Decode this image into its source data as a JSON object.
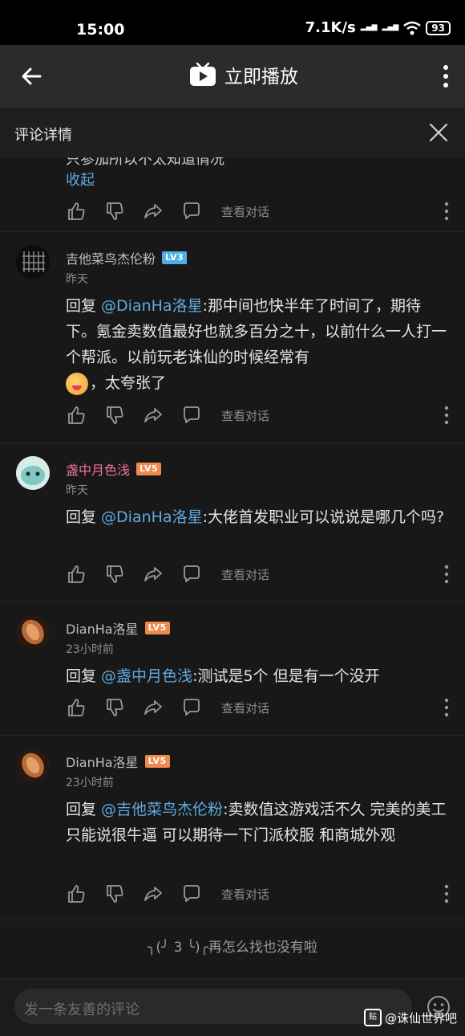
{
  "status_bar": {
    "time": "15:00",
    "net_speed": "7.1K/s",
    "battery": "93"
  },
  "topbar": {
    "title": "立即播放"
  },
  "panel": {
    "title": "评论详情"
  },
  "partial_comment": {
    "text": "只参加所以不太知道情况",
    "collapse": "收起",
    "view_conversation": "查看对话"
  },
  "comments": [
    {
      "username": "吉他菜鸟杰伦粉",
      "level": "LV3",
      "time": "昨天",
      "reply_prefix": "回复 ",
      "mention": "@DianHa洛星",
      "text": ":那中间也快半年了时间了，期待下。氪金卖数值最好也就多百分之十，以前什么一人打一个帮派。以前玩老诛仙的时候经常有",
      "text_after_emoji": "，太夸张了",
      "view_conversation": "查看对话"
    },
    {
      "username": "盏中月色浅",
      "level": "LV5",
      "time": "昨天",
      "reply_prefix": "回复 ",
      "mention": "@DianHa洛星",
      "text": ":大佬首发职业可以说说是哪几个吗?",
      "view_conversation": "查看对话"
    },
    {
      "username": "DianHa洛星",
      "level": "LV5",
      "time": "23小时前",
      "reply_prefix": "回复 ",
      "mention": "@盏中月色浅",
      "text": ":测试是5个 但是有一个没开",
      "view_conversation": "查看对话"
    },
    {
      "username": "DianHa洛星",
      "level": "LV5",
      "time": "23小时前",
      "reply_prefix": "回复 ",
      "mention": "@吉他菜鸟杰伦粉",
      "text": ":卖数值这游戏活不久 完美的美工只能说很牛逼 可以期待一下门派校服 和商城外观",
      "view_conversation": "查看对话"
    }
  ],
  "end_note": "╮(╯ 3 ╰)╭再怎么找也没有啦",
  "composer": {
    "placeholder": "发一条友善的评论"
  },
  "watermark": {
    "logo": "贴",
    "text": "@诛仙世界吧"
  },
  "colors": {
    "mention": "#5fa9de",
    "lv3": "#4fb0e6",
    "lv5": "#f0894a",
    "pink_name": "#f2739f"
  }
}
